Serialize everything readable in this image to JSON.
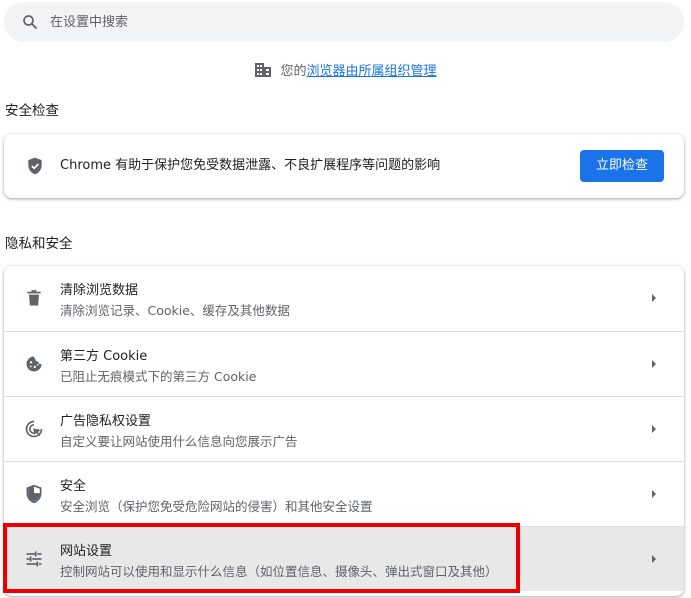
{
  "search": {
    "placeholder": "在设置中搜索"
  },
  "managed": {
    "prefix": "您的",
    "link": "浏览器由所属组织管理"
  },
  "safety_check": {
    "heading": "安全检查",
    "text": "Chrome 有助于保护您免受数据泄露、不良扩展程序等问题的影响",
    "button": "立即检查"
  },
  "privacy": {
    "heading": "隐私和安全",
    "items": [
      {
        "title": "清除浏览数据",
        "subtitle": "清除浏览记录、Cookie、缓存及其他数据",
        "icon": "trash-icon"
      },
      {
        "title": "第三方 Cookie",
        "subtitle": "已阻止无痕模式下的第三方 Cookie",
        "icon": "cookie-icon"
      },
      {
        "title": "广告隐私权设置",
        "subtitle": "自定义要让网站使用什么信息向您展示广告",
        "icon": "ad-privacy-icon"
      },
      {
        "title": "安全",
        "subtitle": "安全浏览（保护您免受危险网站的侵害）和其他安全设置",
        "icon": "security-shield-icon"
      },
      {
        "title": "网站设置",
        "subtitle": "控制网站可以使用和显示什么信息（如位置信息、摄像头、弹出式窗口及其他）",
        "icon": "tune-sliders-icon"
      }
    ]
  },
  "colors": {
    "accent": "#1a73e8",
    "highlight_row": "#e8e8e8",
    "annotation": "#ee0000"
  }
}
